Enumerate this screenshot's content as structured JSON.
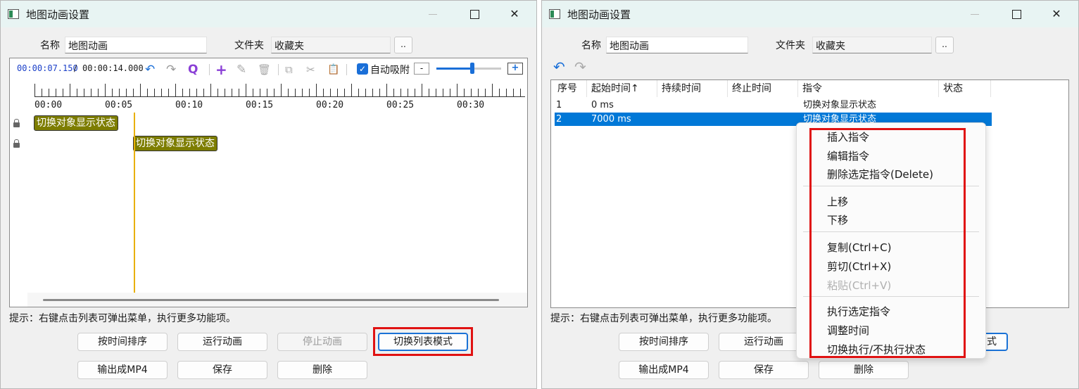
{
  "window_title": "地图动画设置",
  "close_glyph": "✕",
  "form": {
    "name_label": "名称",
    "name_value": "地图动画",
    "folder_label": "文件夹",
    "folder_value": "收藏夹",
    "browse_label": ".."
  },
  "timeline": {
    "current_time": "00:00:07.150",
    "separator": "/",
    "total_time": "00:00:14.000",
    "autosnap_label": "自动吸附",
    "autosnap_checked": true,
    "zoom_minus": "-",
    "zoom_plus": "+",
    "zoom_level": 0.55,
    "ruler_labels": [
      "00:00",
      "00:05",
      "00:10",
      "00:15",
      "00:20",
      "00:25",
      "00:30"
    ],
    "tracks": [
      {
        "clip_label": "切换对象显示状态"
      },
      {
        "clip_label": "切换对象显示状态"
      }
    ]
  },
  "icons": {
    "undo": "↶",
    "redo": "↷",
    "zoom": "Q",
    "add": "+",
    "edit": "✎",
    "delete": "🗑",
    "copy": "⧉",
    "cut": "✂",
    "paste": "📋"
  },
  "hint": "提示：右键点击列表可弹出菜单，执行更多功能项。",
  "buttons": {
    "sort_by_time": "按时间排序",
    "run_animation": "运行动画",
    "stop_animation": "停止动画",
    "switch_list_mode": "切换列表模式",
    "export_mp4": "输出成MP4",
    "save": "保存",
    "delete": "删除",
    "partial_right": "式"
  },
  "list": {
    "columns": [
      "序号",
      "起始时间↑",
      "持续时间",
      "终止时间",
      "指令",
      "状态"
    ],
    "rows": [
      {
        "index": "1",
        "start": "0 ms",
        "duration": "",
        "end": "",
        "command": "切换对象显示状态",
        "status": ""
      },
      {
        "index": "2",
        "start": "7000 ms",
        "duration": "",
        "end": "",
        "command": "切换对象显示状态",
        "status": ""
      }
    ]
  },
  "context_menu": {
    "items": [
      {
        "label": "插入指令",
        "enabled": true
      },
      {
        "label": "编辑指令",
        "enabled": true
      },
      {
        "label": "删除选定指令(Delete)",
        "enabled": true
      },
      {
        "label": "上移",
        "enabled": true
      },
      {
        "label": "下移",
        "enabled": true
      },
      {
        "label": "复制(Ctrl+C)",
        "enabled": true
      },
      {
        "label": "剪切(Ctrl+X)",
        "enabled": true
      },
      {
        "label": "粘贴(Ctrl+V)",
        "enabled": false
      },
      {
        "label": "执行选定指令",
        "enabled": true
      },
      {
        "label": "调整时间",
        "enabled": true
      },
      {
        "label": "切换执行/不执行状态",
        "enabled": true
      }
    ]
  },
  "colors": {
    "highlight_box": "#e01212",
    "selection": "#0078d7",
    "clip_fill": "#7d7d00",
    "playhead": "#e8b000",
    "accent_icon": "#1a6fd8",
    "zoom_icon": "#8a3fd6"
  }
}
